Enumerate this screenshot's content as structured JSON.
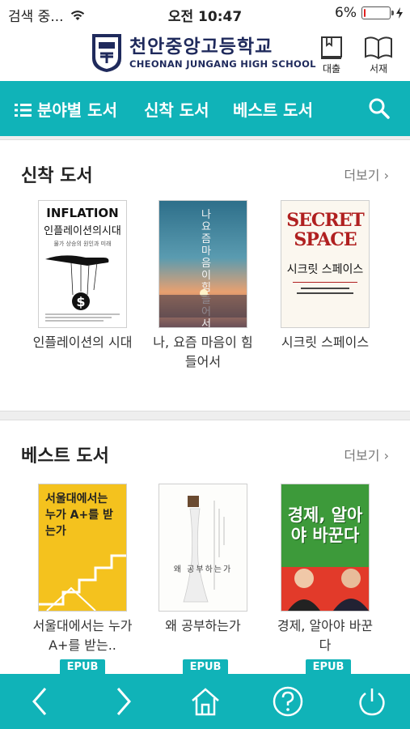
{
  "status": {
    "carrier": "검색 중...",
    "time": "오전 10:47",
    "battery": "6%",
    "battery_level": 0.06
  },
  "school": {
    "name_ko": "천안중앙고등학교",
    "name_en": "CHEONAN JUNGANG HIGH SCHOOL"
  },
  "header_buttons": {
    "loan": "대출",
    "shelf": "서재"
  },
  "nav": {
    "category": "분야별 도서",
    "new": "신착 도서",
    "best": "베스트 도서"
  },
  "new_books": {
    "title": "신착 도서",
    "more": "더보기",
    "books": [
      {
        "title": "인플레이션의 시대",
        "cover": {
          "top": "INFLATION",
          "main": "인플레이션의시대",
          "sub": "물가 상승의 원인과 미래"
        }
      },
      {
        "title": "나, 요즘 마음이 힘들어서",
        "cover": {
          "main": "나 요즘 마음이 힘들어서"
        }
      },
      {
        "title": "시크릿 스페이스",
        "cover": {
          "top": "SECRET SPACE",
          "main": "시크릿 스페이스"
        }
      }
    ]
  },
  "best_books": {
    "title": "베스트 도서",
    "more": "더보기",
    "books": [
      {
        "title": "서울대에서는 누가 A+를 받는..",
        "badge": "EPUB",
        "cover": {
          "main": "서울대에서는 누가 A+를 받는가"
        }
      },
      {
        "title": "왜 공부하는가",
        "badge": "EPUB",
        "cover": {
          "main": "왜 공부하는가"
        }
      },
      {
        "title": "경제, 알아야 바꾼다",
        "badge": "EPUB",
        "cover": {
          "main": "경제, 알아야 바꾼다"
        }
      }
    ]
  },
  "colors": {
    "accent": "#10b3b8",
    "navy": "#1f2a5c"
  }
}
